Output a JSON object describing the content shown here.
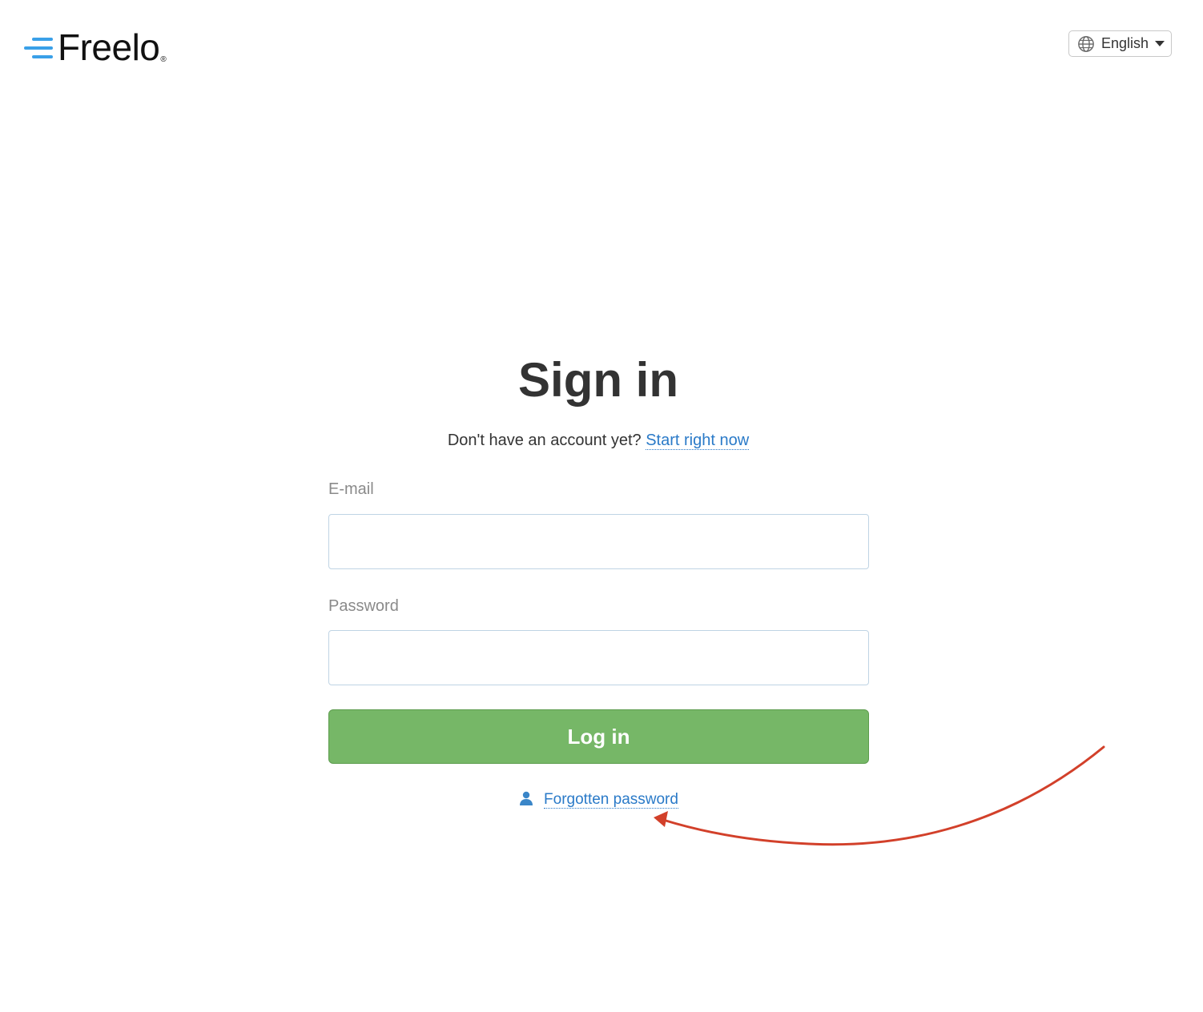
{
  "header": {
    "logo_text": "Freelo",
    "logo_reg": "®",
    "language": "English"
  },
  "form": {
    "title": "Sign in",
    "signup_prompt": "Don't have an account yet?",
    "signup_link": "Start right now",
    "email_label": "E-mail",
    "email_value": "",
    "password_label": "Password",
    "password_value": "",
    "login_button": "Log in",
    "forgot_link": "Forgotten password"
  },
  "icons": {
    "language": "globe-icon",
    "dropdown": "caret-down-icon",
    "forgot": "person-icon"
  },
  "colors": {
    "accent_blue": "#3aa0e8",
    "link": "#2a7ac8",
    "button_green": "#76b767",
    "annotation_arrow": "#d2402a"
  }
}
